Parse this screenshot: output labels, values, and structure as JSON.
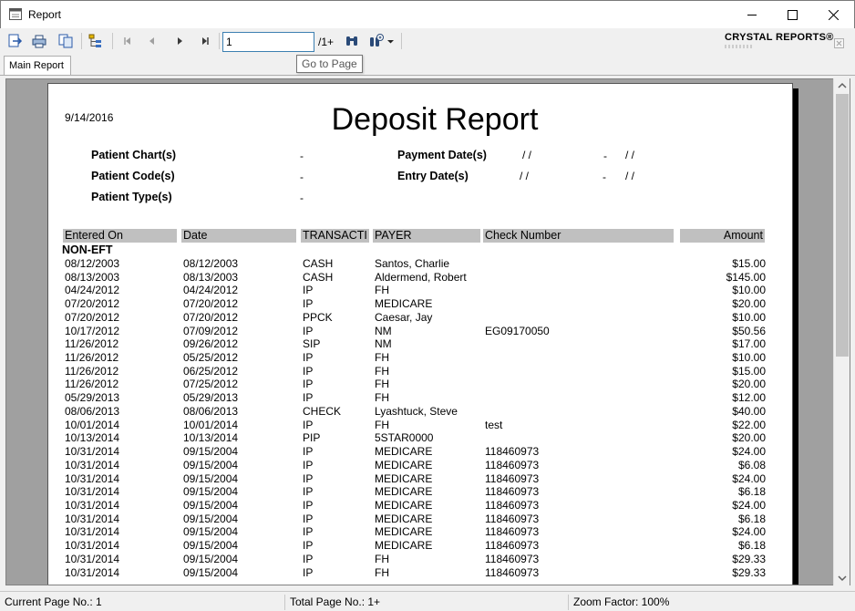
{
  "window": {
    "title": "Report",
    "app_icon": "report-window-icon"
  },
  "toolbar": {
    "page_input_value": "1",
    "page_count": "/1+",
    "brand": "CRYSTAL REPORTS®",
    "tooltip": "Go to Page",
    "icons": [
      "export-icon",
      "print-icon",
      "copy-icon",
      "group-tree-icon",
      "first-page-icon",
      "previous-page-icon",
      "next-page-icon",
      "last-page-icon",
      "find-binoculars-icon",
      "zoom-icon",
      "zoom-dropdown-icon"
    ]
  },
  "tabs": [
    {
      "label": "Main Report"
    }
  ],
  "report": {
    "date": "9/14/2016",
    "title": "Deposit Report",
    "criteria": {
      "patient_chart_label": "Patient Chart(s)",
      "patient_chart_value": "-",
      "patient_code_label": "Patient Code(s)",
      "patient_code_value": "-",
      "patient_type_label": "Patient Type(s)",
      "patient_type_value": "-",
      "payment_date_label": "Payment Date(s)",
      "payment_date_from": "/ /",
      "payment_date_dash": "-",
      "payment_date_to": "/ /",
      "entry_date_label": "Entry Date(s)",
      "entry_date_from": "/ /",
      "entry_date_dash": "-",
      "entry_date_to": "/ /"
    },
    "columns": {
      "entered_on": "Entered On",
      "date": "Date",
      "transaction": "TRANSACTI",
      "payer": "PAYER",
      "check_number": "Check Number",
      "amount": "Amount"
    },
    "group_label": "NON-EFT",
    "rows": [
      [
        "08/12/2003",
        "08/12/2003",
        "CASH",
        "Santos, Charlie",
        "",
        "$15.00"
      ],
      [
        "08/13/2003",
        "08/13/2003",
        "CASH",
        "Aldermend, Robert",
        "",
        "$145.00"
      ],
      [
        "04/24/2012",
        "04/24/2012",
        "IP",
        "FH",
        "",
        "$10.00"
      ],
      [
        "07/20/2012",
        "07/20/2012",
        "IP",
        "MEDICARE",
        "",
        "$20.00"
      ],
      [
        "07/20/2012",
        "07/20/2012",
        "PPCK",
        "Caesar, Jay",
        "",
        "$10.00"
      ],
      [
        "10/17/2012",
        "07/09/2012",
        "IP",
        "NM",
        "EG09170050",
        "$50.56"
      ],
      [
        "11/26/2012",
        "09/26/2012",
        "SIP",
        "NM",
        "",
        "$17.00"
      ],
      [
        "11/26/2012",
        "05/25/2012",
        "IP",
        "FH",
        "",
        "$10.00"
      ],
      [
        "11/26/2012",
        "06/25/2012",
        "IP",
        "FH",
        "",
        "$15.00"
      ],
      [
        "11/26/2012",
        "07/25/2012",
        "IP",
        "FH",
        "",
        "$20.00"
      ],
      [
        "05/29/2013",
        "05/29/2013",
        "IP",
        "FH",
        "",
        "$12.00"
      ],
      [
        "08/06/2013",
        "08/06/2013",
        "CHECK",
        "Lyashtuck, Steve",
        "",
        "$40.00"
      ],
      [
        "10/01/2014",
        "10/01/2014",
        "IP",
        "FH",
        "test",
        "$22.00"
      ],
      [
        "10/13/2014",
        "10/13/2014",
        "PIP",
        "5STAR0000",
        "",
        "$20.00"
      ],
      [
        "10/31/2014",
        "09/15/2004",
        "IP",
        "MEDICARE",
        "118460973",
        "$24.00"
      ],
      [
        "10/31/2014",
        "09/15/2004",
        "IP",
        "MEDICARE",
        "118460973",
        "$6.08"
      ],
      [
        "10/31/2014",
        "09/15/2004",
        "IP",
        "MEDICARE",
        "118460973",
        "$24.00"
      ],
      [
        "10/31/2014",
        "09/15/2004",
        "IP",
        "MEDICARE",
        "118460973",
        "$6.18"
      ],
      [
        "10/31/2014",
        "09/15/2004",
        "IP",
        "MEDICARE",
        "118460973",
        "$24.00"
      ],
      [
        "10/31/2014",
        "09/15/2004",
        "IP",
        "MEDICARE",
        "118460973",
        "$6.18"
      ],
      [
        "10/31/2014",
        "09/15/2004",
        "IP",
        "MEDICARE",
        "118460973",
        "$24.00"
      ],
      [
        "10/31/2014",
        "09/15/2004",
        "IP",
        "MEDICARE",
        "118460973",
        "$6.18"
      ],
      [
        "10/31/2014",
        "09/15/2004",
        "IP",
        "FH",
        "118460973",
        "$29.33"
      ],
      [
        "10/31/2014",
        "09/15/2004",
        "IP",
        "FH",
        "118460973",
        "$29.33"
      ]
    ]
  },
  "statusbar": {
    "current_page": "Current Page No.: 1",
    "total_page": "Total Page No.: 1+",
    "zoom": "Zoom Factor: 100%"
  }
}
